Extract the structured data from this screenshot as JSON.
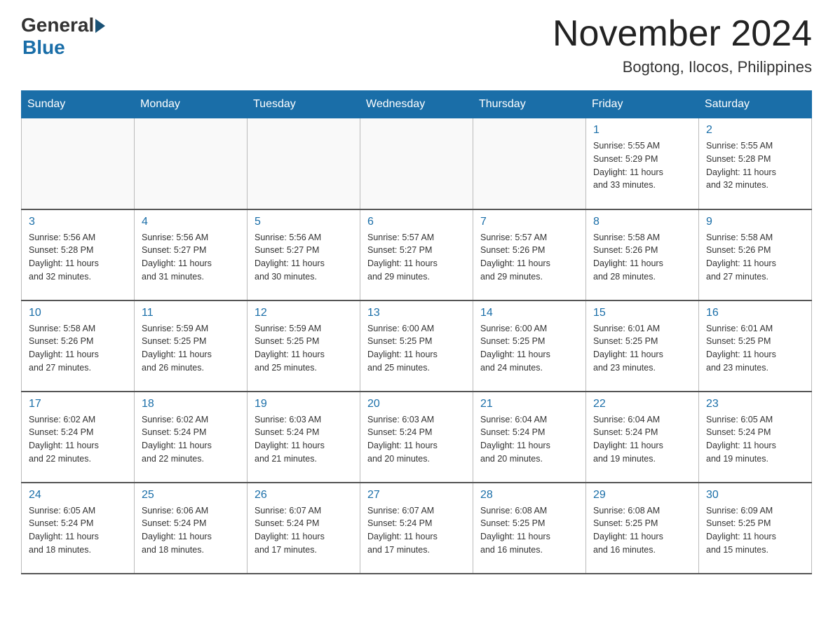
{
  "header": {
    "logo_general": "General",
    "logo_blue": "Blue",
    "month_title": "November 2024",
    "location": "Bogtong, Ilocos, Philippines"
  },
  "weekdays": [
    "Sunday",
    "Monday",
    "Tuesday",
    "Wednesday",
    "Thursday",
    "Friday",
    "Saturday"
  ],
  "weeks": [
    [
      {
        "day": "",
        "info": ""
      },
      {
        "day": "",
        "info": ""
      },
      {
        "day": "",
        "info": ""
      },
      {
        "day": "",
        "info": ""
      },
      {
        "day": "",
        "info": ""
      },
      {
        "day": "1",
        "info": "Sunrise: 5:55 AM\nSunset: 5:29 PM\nDaylight: 11 hours\nand 33 minutes."
      },
      {
        "day": "2",
        "info": "Sunrise: 5:55 AM\nSunset: 5:28 PM\nDaylight: 11 hours\nand 32 minutes."
      }
    ],
    [
      {
        "day": "3",
        "info": "Sunrise: 5:56 AM\nSunset: 5:28 PM\nDaylight: 11 hours\nand 32 minutes."
      },
      {
        "day": "4",
        "info": "Sunrise: 5:56 AM\nSunset: 5:27 PM\nDaylight: 11 hours\nand 31 minutes."
      },
      {
        "day": "5",
        "info": "Sunrise: 5:56 AM\nSunset: 5:27 PM\nDaylight: 11 hours\nand 30 minutes."
      },
      {
        "day": "6",
        "info": "Sunrise: 5:57 AM\nSunset: 5:27 PM\nDaylight: 11 hours\nand 29 minutes."
      },
      {
        "day": "7",
        "info": "Sunrise: 5:57 AM\nSunset: 5:26 PM\nDaylight: 11 hours\nand 29 minutes."
      },
      {
        "day": "8",
        "info": "Sunrise: 5:58 AM\nSunset: 5:26 PM\nDaylight: 11 hours\nand 28 minutes."
      },
      {
        "day": "9",
        "info": "Sunrise: 5:58 AM\nSunset: 5:26 PM\nDaylight: 11 hours\nand 27 minutes."
      }
    ],
    [
      {
        "day": "10",
        "info": "Sunrise: 5:58 AM\nSunset: 5:26 PM\nDaylight: 11 hours\nand 27 minutes."
      },
      {
        "day": "11",
        "info": "Sunrise: 5:59 AM\nSunset: 5:25 PM\nDaylight: 11 hours\nand 26 minutes."
      },
      {
        "day": "12",
        "info": "Sunrise: 5:59 AM\nSunset: 5:25 PM\nDaylight: 11 hours\nand 25 minutes."
      },
      {
        "day": "13",
        "info": "Sunrise: 6:00 AM\nSunset: 5:25 PM\nDaylight: 11 hours\nand 25 minutes."
      },
      {
        "day": "14",
        "info": "Sunrise: 6:00 AM\nSunset: 5:25 PM\nDaylight: 11 hours\nand 24 minutes."
      },
      {
        "day": "15",
        "info": "Sunrise: 6:01 AM\nSunset: 5:25 PM\nDaylight: 11 hours\nand 23 minutes."
      },
      {
        "day": "16",
        "info": "Sunrise: 6:01 AM\nSunset: 5:25 PM\nDaylight: 11 hours\nand 23 minutes."
      }
    ],
    [
      {
        "day": "17",
        "info": "Sunrise: 6:02 AM\nSunset: 5:24 PM\nDaylight: 11 hours\nand 22 minutes."
      },
      {
        "day": "18",
        "info": "Sunrise: 6:02 AM\nSunset: 5:24 PM\nDaylight: 11 hours\nand 22 minutes."
      },
      {
        "day": "19",
        "info": "Sunrise: 6:03 AM\nSunset: 5:24 PM\nDaylight: 11 hours\nand 21 minutes."
      },
      {
        "day": "20",
        "info": "Sunrise: 6:03 AM\nSunset: 5:24 PM\nDaylight: 11 hours\nand 20 minutes."
      },
      {
        "day": "21",
        "info": "Sunrise: 6:04 AM\nSunset: 5:24 PM\nDaylight: 11 hours\nand 20 minutes."
      },
      {
        "day": "22",
        "info": "Sunrise: 6:04 AM\nSunset: 5:24 PM\nDaylight: 11 hours\nand 19 minutes."
      },
      {
        "day": "23",
        "info": "Sunrise: 6:05 AM\nSunset: 5:24 PM\nDaylight: 11 hours\nand 19 minutes."
      }
    ],
    [
      {
        "day": "24",
        "info": "Sunrise: 6:05 AM\nSunset: 5:24 PM\nDaylight: 11 hours\nand 18 minutes."
      },
      {
        "day": "25",
        "info": "Sunrise: 6:06 AM\nSunset: 5:24 PM\nDaylight: 11 hours\nand 18 minutes."
      },
      {
        "day": "26",
        "info": "Sunrise: 6:07 AM\nSunset: 5:24 PM\nDaylight: 11 hours\nand 17 minutes."
      },
      {
        "day": "27",
        "info": "Sunrise: 6:07 AM\nSunset: 5:24 PM\nDaylight: 11 hours\nand 17 minutes."
      },
      {
        "day": "28",
        "info": "Sunrise: 6:08 AM\nSunset: 5:25 PM\nDaylight: 11 hours\nand 16 minutes."
      },
      {
        "day": "29",
        "info": "Sunrise: 6:08 AM\nSunset: 5:25 PM\nDaylight: 11 hours\nand 16 minutes."
      },
      {
        "day": "30",
        "info": "Sunrise: 6:09 AM\nSunset: 5:25 PM\nDaylight: 11 hours\nand 15 minutes."
      }
    ]
  ]
}
